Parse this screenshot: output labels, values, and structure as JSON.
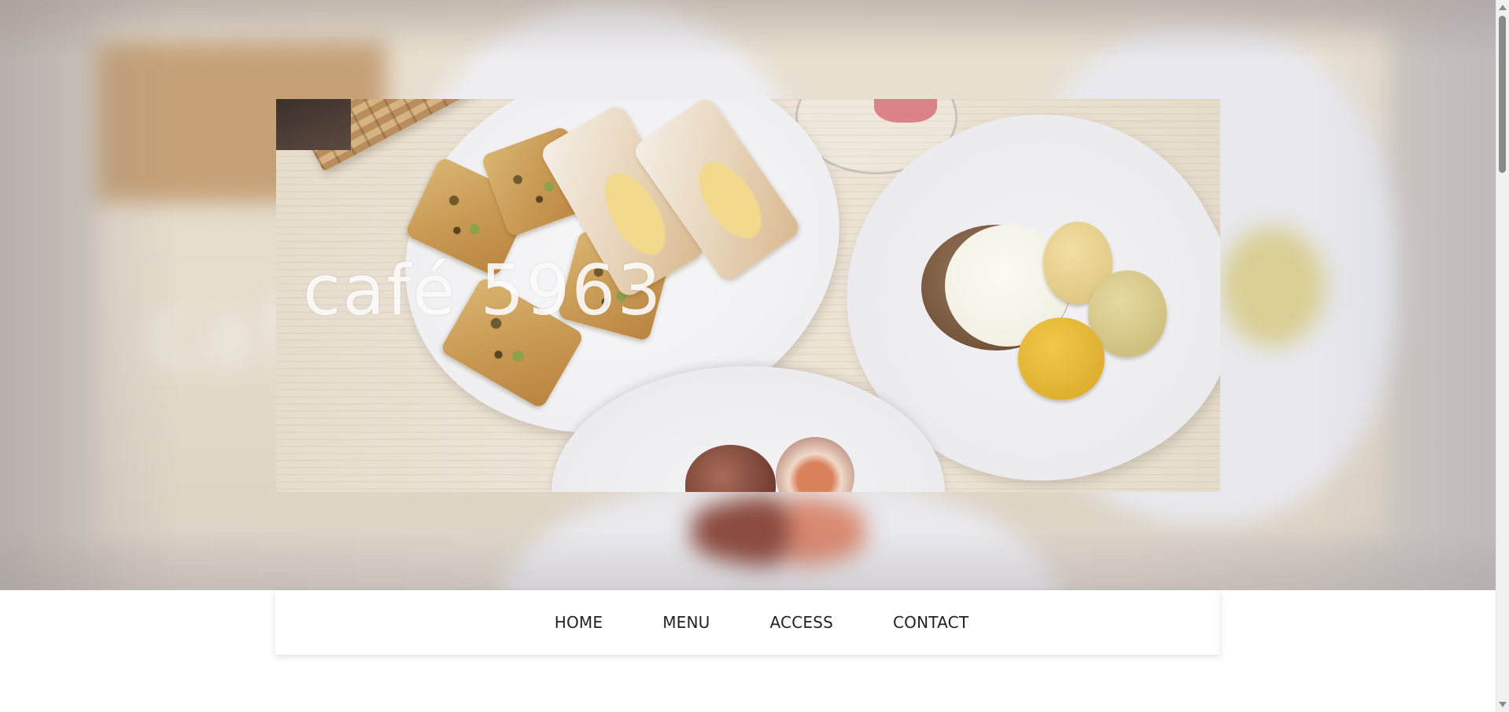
{
  "hero": {
    "logo_text": "café 5963",
    "image_icon": "food-photo"
  },
  "nav": {
    "items": [
      {
        "label": "HOME"
      },
      {
        "label": "MENU"
      },
      {
        "label": "ACCESS"
      },
      {
        "label": "CONTACT"
      }
    ]
  },
  "colors": {
    "nav_background": "#ffffff",
    "nav_text": "#222222",
    "logo_text": "#ffffff"
  },
  "scrollbar": {
    "up_icon": "chevron-up-icon",
    "down_icon": "chevron-down-icon"
  }
}
